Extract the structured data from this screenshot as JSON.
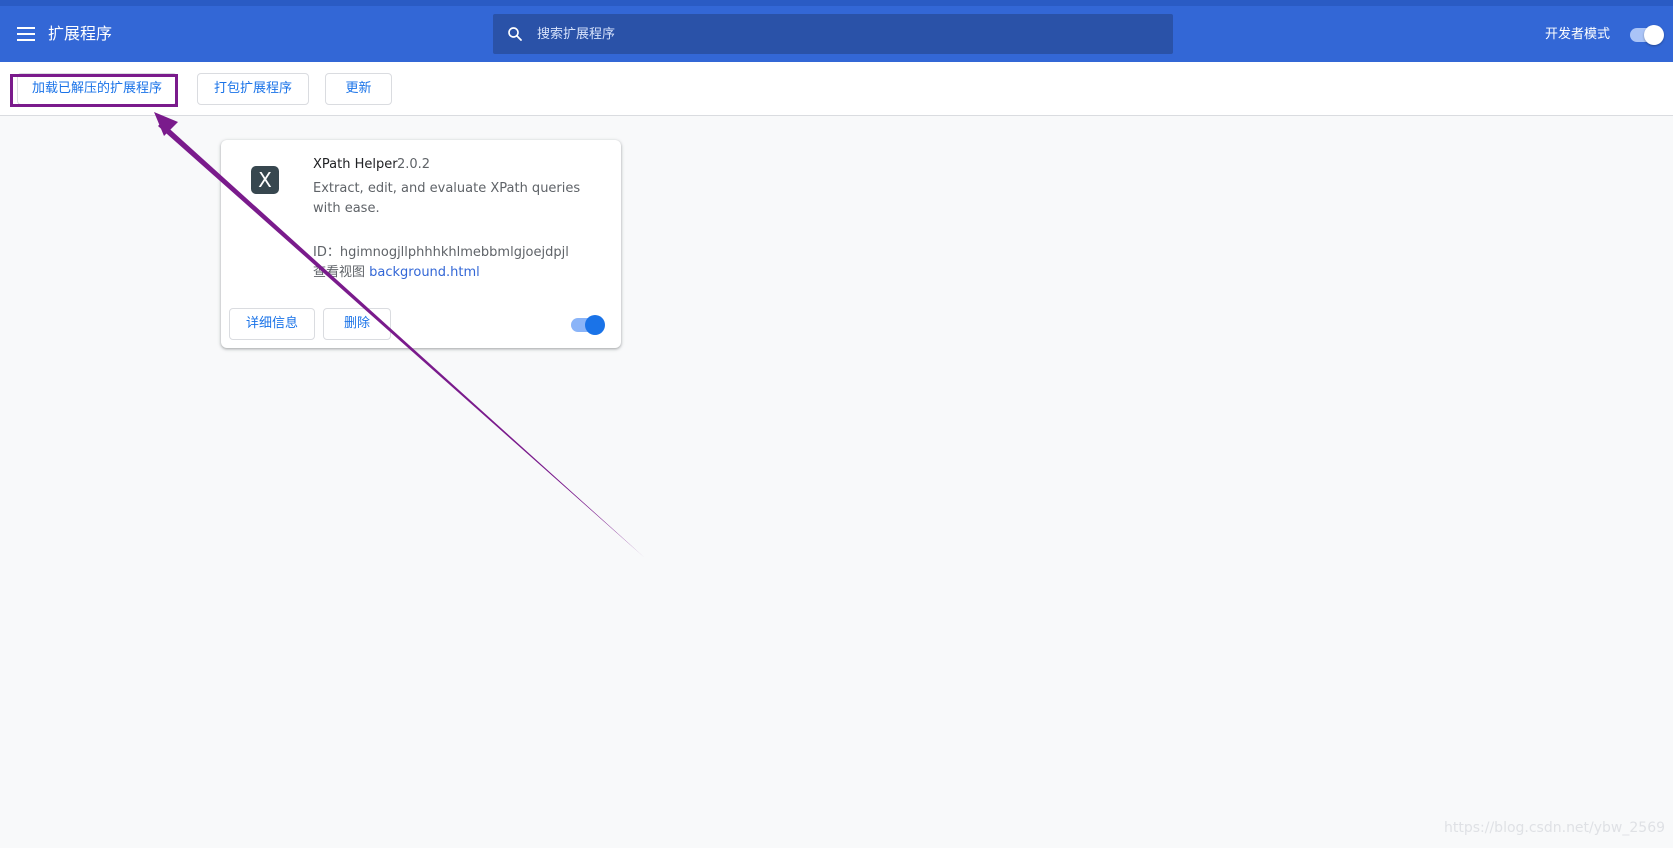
{
  "header": {
    "title": "扩展程序",
    "search_placeholder": "搜索扩展程序",
    "dev_mode_label": "开发者模式",
    "dev_mode_enabled": true
  },
  "toolbar": {
    "load_unpacked_label": "加载已解压的扩展程序",
    "pack_label": "打包扩展程序",
    "update_label": "更新"
  },
  "extension": {
    "icon_glyph": "X",
    "name": "XPath Helper",
    "version": "2.0.2",
    "description": "Extract, edit, and evaluate XPath queries with ease.",
    "id_label": "ID：",
    "id": "hgimnogjllphhhkhlmebbmlgjoejdpjl",
    "views_label": "查看视图",
    "view_link": "background.html",
    "details_label": "详细信息",
    "remove_label": "删除",
    "enabled": true
  },
  "annotation": {
    "color": "#7a1b8c"
  },
  "watermark": "https://blog.csdn.net/ybw_2569",
  "colors": {
    "header_bg": "#3367d6",
    "search_bg": "#2a52a8",
    "accent": "#1a73e8",
    "page_bg": "#f8f9fa"
  }
}
